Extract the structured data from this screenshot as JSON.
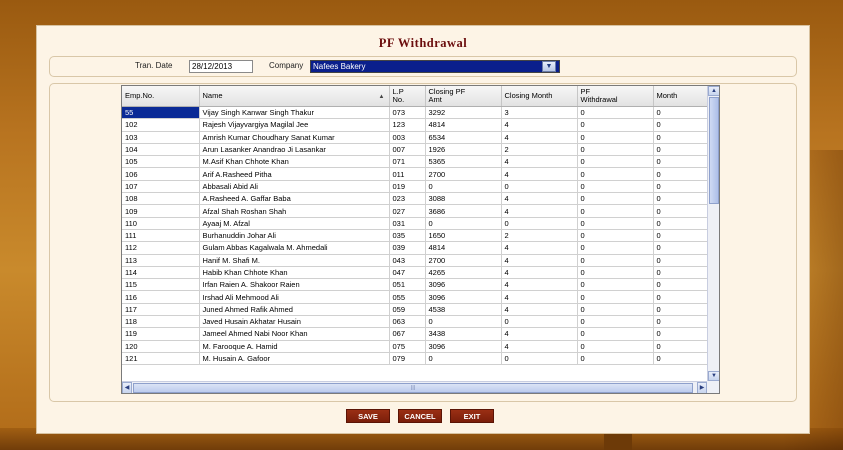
{
  "form": {
    "title": "PF Withdrawal"
  },
  "header": {
    "tran_date_label": "Tran. Date",
    "tran_date_value": "28/12/2013",
    "company_label": "Company",
    "company_value": "Nafees Bakery"
  },
  "grid": {
    "columns": [
      "Emp.No.",
      "Name",
      "L.P\nNo.",
      "Closing PF\nAmt",
      "Closing Month",
      "PF\nWithdrawal",
      "Month"
    ],
    "rows": [
      [
        "55",
        "Vijay Singh Kanwar Singh Thakur",
        "073",
        "3292",
        "3",
        "0",
        "0"
      ],
      [
        "102",
        "Rajesh Vijayvargiya Magilal Jee",
        "123",
        "4814",
        "4",
        "0",
        "0"
      ],
      [
        "103",
        "Amrish Kumar Choudhary Sanat Kumar",
        "003",
        "6534",
        "4",
        "0",
        "0"
      ],
      [
        "104",
        "Arun Lasanker Anandrao Ji Lasankar",
        "007",
        "1926",
        "2",
        "0",
        "0"
      ],
      [
        "105",
        "M.Asif Khan Chhote Khan",
        "071",
        "5365",
        "4",
        "0",
        "0"
      ],
      [
        "106",
        "Arif A.Rasheed Pitha",
        "011",
        "2700",
        "4",
        "0",
        "0"
      ],
      [
        "107",
        "Abbasali Abid Ali",
        "019",
        "0",
        "0",
        "0",
        "0"
      ],
      [
        "108",
        "A.Rasheed A. Gaffar Baba",
        "023",
        "3088",
        "4",
        "0",
        "0"
      ],
      [
        "109",
        "Afzal Shah Roshan Shah",
        "027",
        "3686",
        "4",
        "0",
        "0"
      ],
      [
        "110",
        "Ayaaj M. Afzal",
        "031",
        "0",
        "0",
        "0",
        "0"
      ],
      [
        "111",
        "Burhanuddin Johar Ali",
        "035",
        "1650",
        "2",
        "0",
        "0"
      ],
      [
        "112",
        "Gulam Abbas Kagalwala M. Ahmedali",
        "039",
        "4814",
        "4",
        "0",
        "0"
      ],
      [
        "113",
        "Hanif M. Shafi M.",
        "043",
        "2700",
        "4",
        "0",
        "0"
      ],
      [
        "114",
        "Habib Khan Chhote Khan",
        "047",
        "4265",
        "4",
        "0",
        "0"
      ],
      [
        "115",
        "Irfan Raien A. Shakoor Raien",
        "051",
        "3096",
        "4",
        "0",
        "0"
      ],
      [
        "116",
        "Irshad Ali Mehmood Ali",
        "055",
        "3096",
        "4",
        "0",
        "0"
      ],
      [
        "117",
        "Juned Ahmed Rafik Ahmed",
        "059",
        "4538",
        "4",
        "0",
        "0"
      ],
      [
        "118",
        "Javed Husain Akhatar Husain",
        "063",
        "0",
        "0",
        "0",
        "0"
      ],
      [
        "119",
        "Jameel Ahmed Nabi Noor Khan",
        "067",
        "3438",
        "4",
        "0",
        "0"
      ],
      [
        "120",
        "M. Farooque A. Hamid",
        "075",
        "3096",
        "4",
        "0",
        "0"
      ],
      [
        "121",
        "M. Husain A. Gafoor",
        "079",
        "0",
        "0",
        "0",
        "0"
      ]
    ]
  },
  "buttons": {
    "save": "SAVE",
    "cancel": "CANCEL",
    "exit": "EXIT"
  },
  "colors": {
    "title": "#6b0e0e",
    "button": "#8a2610",
    "selection": "#0a2a96"
  }
}
